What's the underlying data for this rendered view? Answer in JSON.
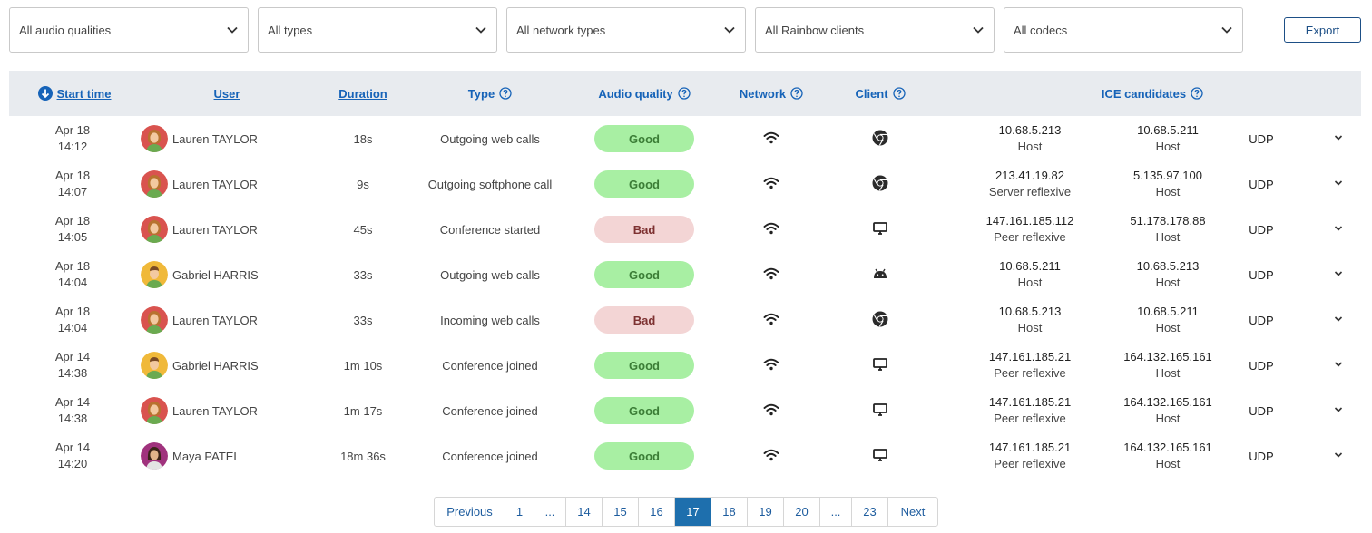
{
  "filters": [
    {
      "label": "All audio qualities"
    },
    {
      "label": "All types"
    },
    {
      "label": "All network types"
    },
    {
      "label": "All Rainbow clients"
    },
    {
      "label": "All codecs"
    }
  ],
  "export_label": "Export",
  "columns": {
    "start_time": "Start time",
    "user": "User",
    "duration": "Duration",
    "type": "Type",
    "audio_quality": "Audio quality",
    "network": "Network",
    "client": "Client",
    "ice": "ICE candidates"
  },
  "rows": [
    {
      "date": "Apr 18",
      "time": "14:12",
      "user": "Lauren TAYLOR",
      "avatar": "lauren",
      "duration": "18s",
      "type": "Outgoing web calls",
      "quality": "Good",
      "client": "chrome",
      "ice_local_ip": "10.68.5.213",
      "ice_local_type": "Host",
      "ice_remote_ip": "10.68.5.211",
      "ice_remote_type": "Host",
      "protocol": "UDP"
    },
    {
      "date": "Apr 18",
      "time": "14:07",
      "user": "Lauren TAYLOR",
      "avatar": "lauren",
      "duration": "9s",
      "type": "Outgoing softphone call",
      "quality": "Good",
      "client": "chrome",
      "ice_local_ip": "213.41.19.82",
      "ice_local_type": "Server reflexive",
      "ice_remote_ip": "5.135.97.100",
      "ice_remote_type": "Host",
      "protocol": "UDP"
    },
    {
      "date": "Apr 18",
      "time": "14:05",
      "user": "Lauren TAYLOR",
      "avatar": "lauren",
      "duration": "45s",
      "type": "Conference started",
      "quality": "Bad",
      "client": "desktop",
      "ice_local_ip": "147.161.185.112",
      "ice_local_type": "Peer reflexive",
      "ice_remote_ip": "51.178.178.88",
      "ice_remote_type": "Host",
      "protocol": "UDP"
    },
    {
      "date": "Apr 18",
      "time": "14:04",
      "user": "Gabriel HARRIS",
      "avatar": "gabriel",
      "duration": "33s",
      "type": "Outgoing web calls",
      "quality": "Good",
      "client": "android",
      "ice_local_ip": "10.68.5.211",
      "ice_local_type": "Host",
      "ice_remote_ip": "10.68.5.213",
      "ice_remote_type": "Host",
      "protocol": "UDP"
    },
    {
      "date": "Apr 18",
      "time": "14:04",
      "user": "Lauren TAYLOR",
      "avatar": "lauren",
      "duration": "33s",
      "type": "Incoming web calls",
      "quality": "Bad",
      "client": "chrome",
      "ice_local_ip": "10.68.5.213",
      "ice_local_type": "Host",
      "ice_remote_ip": "10.68.5.211",
      "ice_remote_type": "Host",
      "protocol": "UDP"
    },
    {
      "date": "Apr 14",
      "time": "14:38",
      "user": "Gabriel HARRIS",
      "avatar": "gabriel",
      "duration": "1m 10s",
      "type": "Conference joined",
      "quality": "Good",
      "client": "desktop",
      "ice_local_ip": "147.161.185.21",
      "ice_local_type": "Peer reflexive",
      "ice_remote_ip": "164.132.165.161",
      "ice_remote_type": "Host",
      "protocol": "UDP"
    },
    {
      "date": "Apr 14",
      "time": "14:38",
      "user": "Lauren TAYLOR",
      "avatar": "lauren",
      "duration": "1m 17s",
      "type": "Conference joined",
      "quality": "Good",
      "client": "desktop",
      "ice_local_ip": "147.161.185.21",
      "ice_local_type": "Peer reflexive",
      "ice_remote_ip": "164.132.165.161",
      "ice_remote_type": "Host",
      "protocol": "UDP"
    },
    {
      "date": "Apr 14",
      "time": "14:20",
      "user": "Maya PATEL",
      "avatar": "maya",
      "duration": "18m 36s",
      "type": "Conference joined",
      "quality": "Good",
      "client": "desktop",
      "ice_local_ip": "147.161.185.21",
      "ice_local_type": "Peer reflexive",
      "ice_remote_ip": "164.132.165.161",
      "ice_remote_type": "Host",
      "protocol": "UDP"
    }
  ],
  "pagination": {
    "items": [
      "Previous",
      "1",
      "...",
      "14",
      "15",
      "16",
      "17",
      "18",
      "19",
      "20",
      "...",
      "23",
      "Next"
    ],
    "active": "17"
  },
  "colors": {
    "accent": "#1663b8",
    "good_bg": "#a8efa3",
    "bad_bg": "#f3d5d5",
    "header_bg": "#e8ebef",
    "active_page": "#1e6fad"
  }
}
